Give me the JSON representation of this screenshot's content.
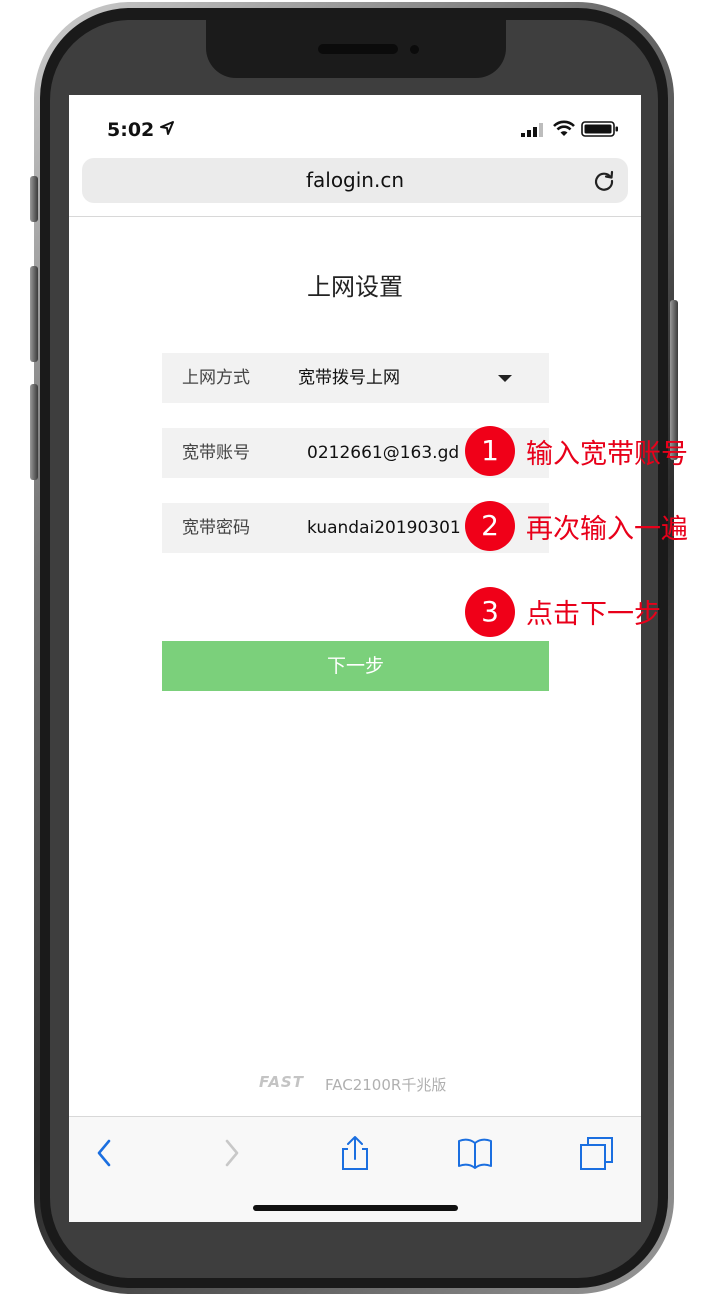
{
  "status_bar": {
    "time": "5:02"
  },
  "browser": {
    "url": "falogin.cn"
  },
  "page": {
    "title": "上网设置",
    "connection_type": {
      "label": "上网方式",
      "value": "宽带拨号上网"
    },
    "account": {
      "label": "宽带账号",
      "value": "0212661@163.gd"
    },
    "password": {
      "label": "宽带密码",
      "value": "kuandai20190301"
    },
    "next_button": "下一步",
    "footer": {
      "brand": "FAST",
      "model": "FAC2100R千兆版"
    }
  },
  "annotations": [
    {
      "number": "1",
      "text": "输入宽带账号"
    },
    {
      "number": "2",
      "text": "再次输入一遍"
    },
    {
      "number": "3",
      "text": "点击下一步"
    }
  ],
  "colors": {
    "button_green": "#7bd07b",
    "marker_red": "#f00018",
    "annotation_red": "#e8001a",
    "link_blue": "#1b6fe0"
  },
  "icons": {
    "status": [
      "location-arrow-icon",
      "cellular-signal-icon",
      "wifi-icon",
      "battery-icon"
    ],
    "browser": [
      "reload-icon"
    ],
    "toolbar": [
      "back-icon",
      "forward-icon",
      "share-icon",
      "bookmarks-icon",
      "tabs-icon"
    ]
  }
}
